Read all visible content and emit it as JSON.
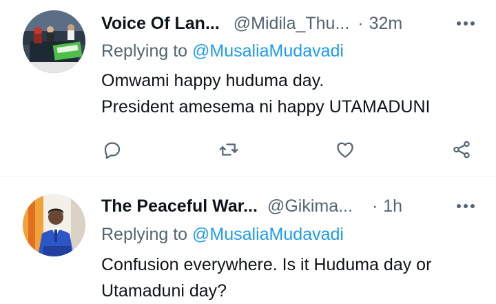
{
  "tweets": [
    {
      "display_name": "Voice Of Lan...",
      "handle": "@Midila_Thu...",
      "separator": "·",
      "time": "32m",
      "replying_prefix": "Replying to",
      "replying_to": "@MusaliaMudavadi",
      "text_lines": [
        "Omwami happy huduma day.",
        "President amesema ni happy UTAMADUNI"
      ],
      "avatar_icon": "tv-studio-avatar"
    },
    {
      "display_name": "The Peaceful War...",
      "handle": "@Gikima...",
      "separator": "·",
      "time": "1h",
      "replying_prefix": "Replying to",
      "replying_to": "@MusaliaMudavadi",
      "text_lines": [
        "Confusion everywhere. Is it Huduma day or",
        "Utamaduni day?"
      ],
      "avatar_icon": "man-in-suit-avatar"
    }
  ],
  "icons": {
    "more": "more-icon",
    "reply": "reply-icon",
    "retweet": "retweet-icon",
    "like": "like-icon",
    "share": "share-icon"
  },
  "colors": {
    "text_primary": "#0f1419",
    "text_secondary": "#536471",
    "accent": "#1d9bf0",
    "divider": "#eff3f4"
  }
}
